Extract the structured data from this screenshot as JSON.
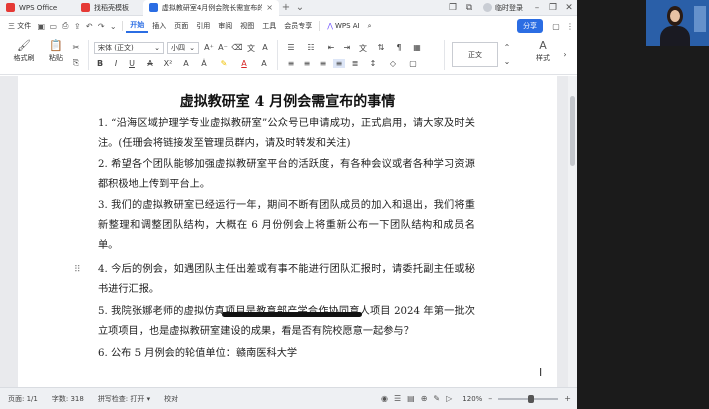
{
  "title_bar": {
    "tabs": [
      {
        "label": "WPS Office"
      },
      {
        "label": "找稻壳模板"
      },
      {
        "label": "虚拟教研室4月例会院长需宣布的"
      }
    ],
    "login_label": "临时登录"
  },
  "menu_bar": {
    "file_label": "三 文件",
    "items": [
      "开始",
      "插入",
      "页面",
      "引用",
      "审阅",
      "视图",
      "工具",
      "会员专享"
    ],
    "ai_label": "WPS AI",
    "share_label": "分享"
  },
  "ribbon": {
    "format_painter": "格式刷",
    "paste": "粘贴",
    "font_name": "宋体 (正文)",
    "font_size": "小四",
    "style_normal": "正文",
    "style_set": "样式"
  },
  "document": {
    "title": "虚拟教研室 4 月例会需宣布的事情",
    "paragraphs": [
      "1. “沿海区域护理学专业虚拟教研室”公众号已申请成功，正式启用，请大家及时关注。(任珊会将链接发至管理员群内，请及时转发和关注)",
      "2. 希望各个团队能够加强虚拟教研室平台的活跃度，有各种会议或者各种学习资源都积极地上传到平台上。",
      "3. 我们的虚拟教研室已经运行一年，期间不断有团队成员的加入和退出，我们将重新整理和调整团队结构，大概在 6 月份例会上将重新公布一下团队结构和成员名单。",
      "4. 今后的例会，如遇团队主任出差或有事不能进行团队汇报时，请委托副主任或秘书进行汇报。",
      "5. 我院张娜老师的虚拟仿真项目是教育部产学合作协同育人项目 2024 年第一批次立项项目，也是虚拟教研室建设的成果，看是否有院校愿意一起参与？",
      "6. 公布 5 月例会的轮值单位：赣南医科大学"
    ]
  },
  "status_bar": {
    "page": "页面: 1/1",
    "words": "字数: 318",
    "spell": "拼写检查: 打开 ▾",
    "proof": "校对",
    "zoom": "120%"
  },
  "colors": {
    "accent": "#2b6de3",
    "share_button": "#2b6de3"
  }
}
